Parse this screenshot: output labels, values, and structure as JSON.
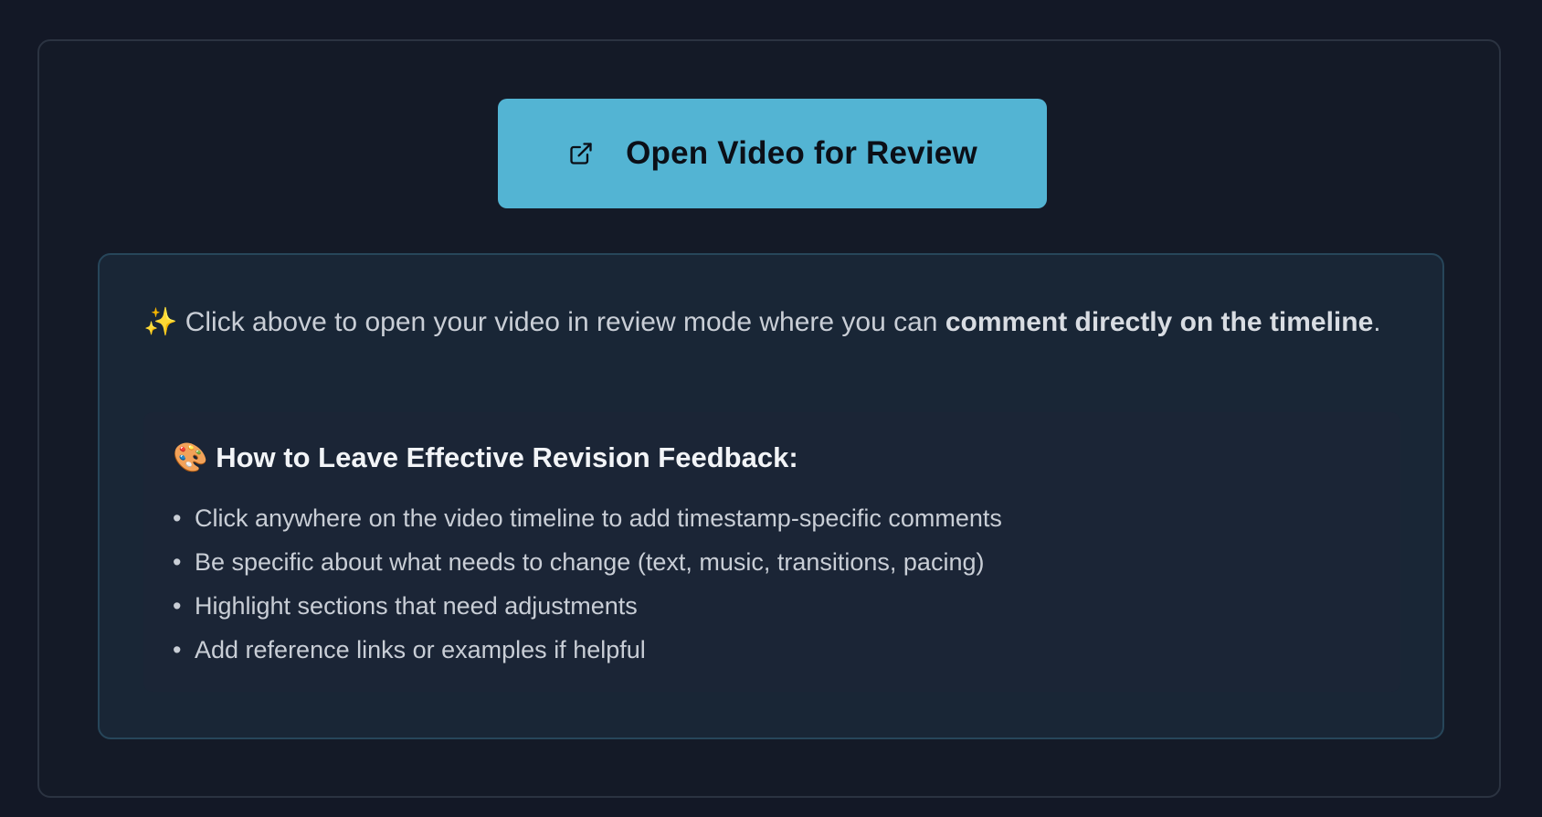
{
  "button": {
    "label": "Open Video for Review",
    "icon": "external-link-icon",
    "color": "#53b4d3"
  },
  "intro": {
    "emoji": "✨",
    "text_before": " Click above to open your video in review mode where you can ",
    "bold_text": "comment directly on the timeline",
    "text_after": "."
  },
  "tips": {
    "emoji": "🎨",
    "title": " How to Leave Effective Revision Feedback:",
    "bullet": "•",
    "items": [
      "Click anywhere on the video timeline to add timestamp-specific comments",
      "Be specific about what needs to change (text, music, transitions, pacing)",
      "Highlight sections that need adjustments",
      "Add reference links or examples if helpful"
    ]
  }
}
